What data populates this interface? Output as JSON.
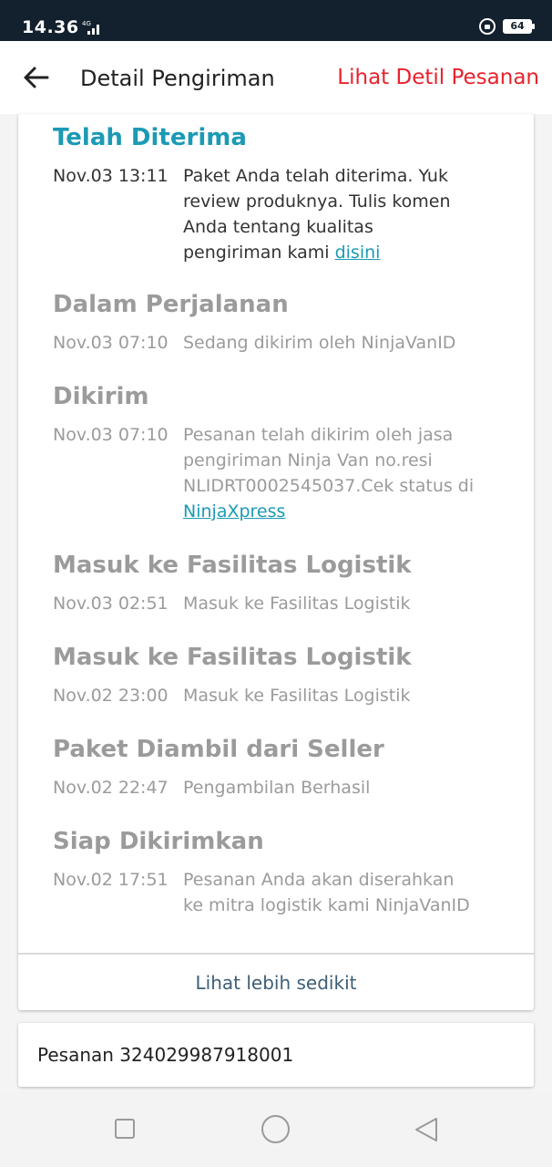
{
  "status_bar": {
    "time": "14.36",
    "network": "4G",
    "battery": "64"
  },
  "header": {
    "title": "Detail Pengiriman",
    "link": "Lihat Detil Pesanan"
  },
  "timeline": [
    {
      "status": "Telah Diterima",
      "date": "Nov.03 13:11",
      "desc": "Paket Anda telah diterima. Yuk review produknya. Tulis komen Anda tentang kualitas pengiriman kami ",
      "link": "disini"
    },
    {
      "status": "Dalam Perjalanan",
      "date": "Nov.03 07:10",
      "desc": "Sedang dikirim oleh NinjaVanID"
    },
    {
      "status": "Dikirim",
      "date": "Nov.03 07:10",
      "desc": "Pesanan telah dikirim oleh jasa pengiriman Ninja Van no.resi NLIDRT0002545037.Cek status di ",
      "link": "NinjaXpress"
    },
    {
      "status": "Masuk ke Fasilitas Logistik",
      "date": "Nov.03 02:51",
      "desc": "Masuk ke Fasilitas Logistik"
    },
    {
      "status": "Masuk ke Fasilitas Logistik",
      "date": "Nov.02 23:00",
      "desc": "Masuk ke Fasilitas Logistik"
    },
    {
      "status": "Paket Diambil dari Seller",
      "date": "Nov.02 22:47",
      "desc": "Pengambilan Berhasil"
    },
    {
      "status": "Siap Dikirimkan",
      "date": "Nov.02 17:51",
      "desc": "Pesanan Anda akan diserahkan ke mitra logistik kami NinjaVanID"
    }
  ],
  "show_less": "Lihat lebih sedikit",
  "order": "Pesanan 324029987918001",
  "colors": {
    "active": "#1b9ab5",
    "inactive": "#9b9b9b",
    "header_link": "#e8222d",
    "status_bar": "#13212e"
  }
}
